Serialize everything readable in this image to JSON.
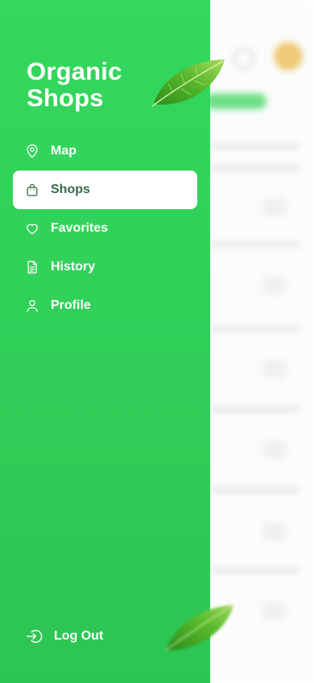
{
  "brand": {
    "line1": "Organic",
    "line2": "Shops"
  },
  "nav": [
    {
      "label": "Map",
      "icon": "map-pin-icon",
      "active": false
    },
    {
      "label": "Shops",
      "icon": "shopping-bag-icon",
      "active": true
    },
    {
      "label": "Favorites",
      "icon": "heart-icon",
      "active": false
    },
    {
      "label": "History",
      "icon": "document-icon",
      "active": false
    },
    {
      "label": "Profile",
      "icon": "user-icon",
      "active": false
    }
  ],
  "logout": {
    "label": "Log Out",
    "icon": "logout-icon"
  },
  "colors": {
    "drawer": "#34d85d",
    "active_text": "#3a6a49",
    "white": "#ffffff"
  }
}
